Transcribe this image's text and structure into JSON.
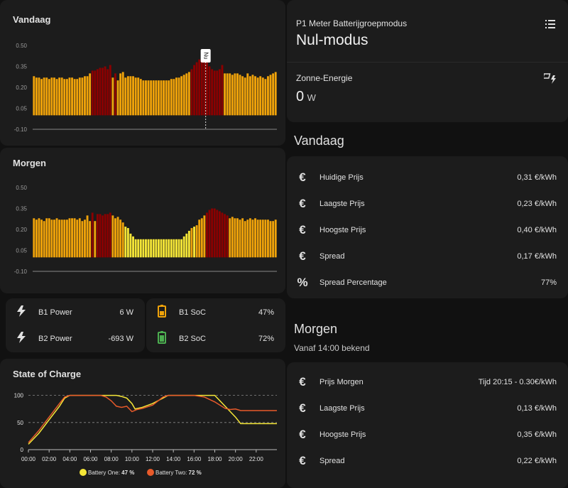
{
  "colors": {
    "orange": "#f0a30a",
    "darkred": "#8b0000",
    "yellow": "#f5e637",
    "bg": "#111111",
    "card": "#1c1c1c"
  },
  "vandaag_chart": {
    "title": "Vandaag",
    "now_label": "Nu",
    "yticks": [
      "0.50",
      "0.35",
      "0.20",
      "0.05",
      "-0.10"
    ],
    "chart_data": {
      "type": "bar",
      "ylim": [
        -0.1,
        0.5
      ],
      "now_index": 68,
      "values": [
        0.28,
        0.27,
        0.27,
        0.26,
        0.27,
        0.27,
        0.26,
        0.27,
        0.27,
        0.26,
        0.27,
        0.27,
        0.26,
        0.26,
        0.27,
        0.27,
        0.26,
        0.26,
        0.27,
        0.27,
        0.28,
        0.28,
        0.3,
        0.32,
        0.32,
        0.33,
        0.34,
        0.34,
        0.35,
        0.33,
        0.36,
        0.27,
        0.3,
        0.25,
        0.3,
        0.31,
        0.27,
        0.28,
        0.28,
        0.28,
        0.27,
        0.27,
        0.26,
        0.25,
        0.25,
        0.25,
        0.25,
        0.25,
        0.25,
        0.25,
        0.25,
        0.25,
        0.25,
        0.25,
        0.26,
        0.26,
        0.27,
        0.27,
        0.28,
        0.29,
        0.3,
        0.31,
        0.33,
        0.36,
        0.38,
        0.4,
        0.4,
        0.39,
        0.38,
        0.35,
        0.33,
        0.32,
        0.32,
        0.33,
        0.36,
        0.3,
        0.3,
        0.3,
        0.29,
        0.3,
        0.3,
        0.29,
        0.28,
        0.27,
        0.3,
        0.28,
        0.29,
        0.28,
        0.27,
        0.28,
        0.27,
        0.26,
        0.28,
        0.29,
        0.3,
        0.31
      ],
      "colors": [
        "o",
        "o",
        "o",
        "o",
        "o",
        "o",
        "o",
        "o",
        "o",
        "o",
        "o",
        "o",
        "o",
        "o",
        "o",
        "o",
        "o",
        "o",
        "o",
        "o",
        "o",
        "o",
        "o",
        "r",
        "r",
        "r",
        "r",
        "r",
        "r",
        "r",
        "r",
        "o",
        "r",
        "o",
        "o",
        "o",
        "o",
        "o",
        "o",
        "o",
        "o",
        "o",
        "o",
        "o",
        "o",
        "o",
        "o",
        "o",
        "o",
        "o",
        "o",
        "o",
        "o",
        "o",
        "o",
        "o",
        "o",
        "o",
        "o",
        "o",
        "o",
        "o",
        "r",
        "r",
        "r",
        "r",
        "r",
        "r",
        "r",
        "r",
        "r",
        "r",
        "r",
        "r",
        "r",
        "o",
        "o",
        "o",
        "o",
        "o",
        "o",
        "o",
        "o",
        "o",
        "o",
        "o",
        "o",
        "o",
        "o",
        "o",
        "o",
        "o",
        "o",
        "o",
        "o",
        "o"
      ]
    }
  },
  "morgen_chart": {
    "title": "Morgen",
    "yticks": [
      "0.50",
      "0.35",
      "0.20",
      "0.05",
      "-0.10"
    ],
    "chart_data": {
      "type": "bar",
      "ylim": [
        -0.1,
        0.5
      ],
      "values": [
        0.28,
        0.27,
        0.28,
        0.27,
        0.26,
        0.28,
        0.28,
        0.27,
        0.27,
        0.28,
        0.27,
        0.27,
        0.27,
        0.27,
        0.28,
        0.28,
        0.28,
        0.27,
        0.28,
        0.26,
        0.27,
        0.3,
        0.26,
        0.32,
        0.26,
        0.31,
        0.31,
        0.3,
        0.31,
        0.31,
        0.32,
        0.3,
        0.28,
        0.29,
        0.27,
        0.25,
        0.22,
        0.21,
        0.17,
        0.15,
        0.13,
        0.13,
        0.13,
        0.13,
        0.13,
        0.13,
        0.13,
        0.13,
        0.13,
        0.13,
        0.13,
        0.13,
        0.13,
        0.13,
        0.13,
        0.13,
        0.13,
        0.13,
        0.13,
        0.15,
        0.17,
        0.19,
        0.21,
        0.22,
        0.23,
        0.27,
        0.28,
        0.3,
        0.32,
        0.34,
        0.35,
        0.35,
        0.34,
        0.33,
        0.32,
        0.31,
        0.3,
        0.28,
        0.29,
        0.28,
        0.28,
        0.27,
        0.28,
        0.26,
        0.27,
        0.28,
        0.27,
        0.28,
        0.27,
        0.27,
        0.27,
        0.27,
        0.27,
        0.26,
        0.26,
        0.27
      ],
      "colors": [
        "o",
        "o",
        "o",
        "o",
        "o",
        "o",
        "o",
        "o",
        "o",
        "o",
        "o",
        "o",
        "o",
        "o",
        "o",
        "o",
        "o",
        "o",
        "o",
        "o",
        "o",
        "o",
        "o",
        "r",
        "o",
        "r",
        "r",
        "r",
        "r",
        "r",
        "r",
        "o",
        "o",
        "o",
        "o",
        "o",
        "y",
        "y",
        "y",
        "y",
        "y",
        "y",
        "y",
        "y",
        "y",
        "y",
        "y",
        "y",
        "y",
        "y",
        "y",
        "y",
        "y",
        "y",
        "y",
        "y",
        "y",
        "y",
        "y",
        "y",
        "y",
        "y",
        "o",
        "y",
        "o",
        "o",
        "o",
        "o",
        "r",
        "r",
        "r",
        "r",
        "r",
        "r",
        "r",
        "r",
        "r",
        "o",
        "o",
        "o",
        "o",
        "o",
        "o",
        "o",
        "o",
        "o",
        "o",
        "o",
        "o",
        "o",
        "o",
        "o",
        "o",
        "o",
        "o",
        "o"
      ]
    }
  },
  "battery": {
    "b1_power_label": "B1 Power",
    "b1_power_value": "6 W",
    "b2_power_label": "B2 Power",
    "b2_power_value": "-693 W",
    "b1_soc_label": "B1 SoC",
    "b1_soc_value": "47%",
    "b2_soc_label": "B2 SoC",
    "b2_soc_value": "72%"
  },
  "soc_chart": {
    "title": "State of Charge",
    "yticks": [
      "100",
      "50",
      "0"
    ],
    "xticks": [
      "00:00",
      "02:00",
      "04:00",
      "06:00",
      "08:00",
      "10:00",
      "12:00",
      "14:00",
      "16:00",
      "18:00",
      "20:00",
      "22:00"
    ],
    "legend_one": "Battery One:",
    "legend_one_val": "47 %",
    "legend_two": "Battery Two:",
    "legend_two_val": "72 %",
    "chart_data": {
      "type": "line",
      "ylim": [
        0,
        110
      ],
      "xlim": [
        0,
        24
      ],
      "series": [
        {
          "name": "Battery One",
          "color": "#f5e637",
          "x": [
            0,
            1,
            2,
            3,
            3.5,
            4,
            6,
            7,
            8,
            8.5,
            9,
            9.5,
            10,
            10.3,
            11,
            12,
            12.5,
            13,
            13.5,
            14,
            16,
            17,
            18,
            18.5,
            19,
            20,
            20.5,
            22,
            24
          ],
          "y": [
            10,
            30,
            55,
            80,
            95,
            100,
            100,
            100,
            100,
            100,
            98,
            95,
            85,
            75,
            78,
            85,
            90,
            95,
            100,
            100,
            100,
            100,
            100,
            90,
            80,
            60,
            48,
            48,
            48
          ]
        },
        {
          "name": "Battery Two",
          "color": "#e85a2a",
          "x": [
            0,
            1,
            2,
            3,
            3.5,
            4,
            6,
            7,
            7.5,
            8,
            8.5,
            9,
            9.5,
            10,
            10.5,
            11,
            12,
            13,
            13.5,
            14,
            16,
            17,
            18,
            19,
            19.5,
            20,
            20.5,
            22,
            24
          ],
          "y": [
            13,
            35,
            60,
            85,
            97,
            100,
            100,
            100,
            97,
            90,
            80,
            78,
            80,
            70,
            74,
            76,
            82,
            97,
            100,
            100,
            100,
            97,
            88,
            76,
            74,
            75,
            72,
            72,
            72
          ]
        }
      ]
    }
  },
  "p1": {
    "subtitle": "P1 Meter Batterijgroepmodus",
    "title": "Nul-modus",
    "zonne_label": "Zonne-Energie",
    "zonne_value": "0",
    "zonne_unit": "W"
  },
  "vandaag_section": {
    "title": "Vandaag",
    "rows": [
      {
        "icon": "€",
        "label": "Huidige Prijs",
        "value": "0,31 €/kWh"
      },
      {
        "icon": "€",
        "label": "Laagste Prijs",
        "value": "0,23 €/kWh"
      },
      {
        "icon": "€",
        "label": "Hoogste Prijs",
        "value": "0,40 €/kWh"
      },
      {
        "icon": "€",
        "label": "Spread",
        "value": "0,17 €/kWh"
      },
      {
        "icon": "%",
        "label": "Spread Percentage",
        "value": "77%"
      }
    ]
  },
  "morgen_section": {
    "title": "Morgen",
    "subtitle": "Vanaf 14:00 bekend",
    "rows": [
      {
        "icon": "€",
        "label": "Prijs Morgen",
        "value": "Tijd 20:15 - 0.30€/kWh"
      },
      {
        "icon": "€",
        "label": "Laagste Prijs",
        "value": "0,13 €/kWh"
      },
      {
        "icon": "€",
        "label": "Hoogste Prijs",
        "value": "0,35 €/kWh"
      },
      {
        "icon": "€",
        "label": "Spread",
        "value": "0,22 €/kWh"
      }
    ]
  }
}
